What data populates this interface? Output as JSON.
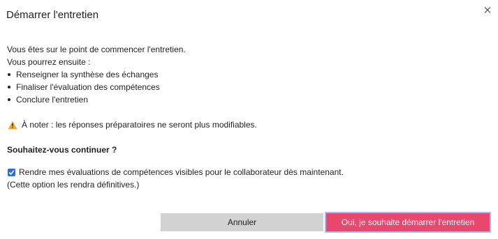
{
  "dialog": {
    "title": "Démarrer l'entretien",
    "close_label": "×"
  },
  "content": {
    "intro": "Vous êtes sur le point de commencer l'entretien.",
    "next_steps_label": "Vous pourrez ensuite :",
    "steps": [
      "Renseigner la synthèse des échanges",
      "Finaliser l'évaluation des compétences",
      "Conclure l'entretien"
    ],
    "warning": "À noter : les réponses préparatoires ne seront plus modifiables.",
    "question": "Souhaitez-vous continuer ?",
    "checkbox_label": "Rendre mes évaluations de compétences visibles pour le collaborateur dès maintenant.",
    "checkbox_checked": true,
    "checkbox_note": "(Cette option les rendra définitives.)"
  },
  "buttons": {
    "cancel": "Annuler",
    "confirm": "Oui, je souhaite démarrer l'entretien"
  },
  "colors": {
    "confirm_bg": "#e8476e",
    "cancel_bg": "#d2d2d2",
    "checkbox": "#2b6fd1",
    "warning": "#f0a830"
  },
  "icons": {
    "close": "close-icon",
    "warning": "warning-icon",
    "check": "checkmark-icon"
  }
}
